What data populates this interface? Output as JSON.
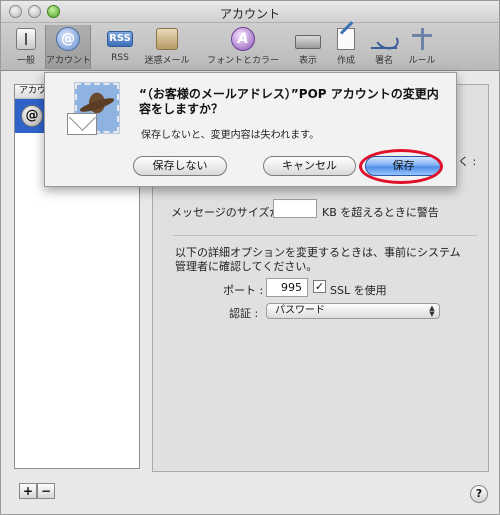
{
  "window": {
    "title": "アカウント"
  },
  "toolbar": {
    "items": [
      {
        "label": "一般",
        "icon": "general-icon"
      },
      {
        "label": "アカウント",
        "icon": "account-icon"
      },
      {
        "label": "RSS",
        "icon": "rss-icon",
        "icon_text": "RSS"
      },
      {
        "label": "迷惑メール",
        "icon": "junk-icon"
      },
      {
        "label": "フォントとカラー",
        "icon": "font-color-icon"
      },
      {
        "label": "表示",
        "icon": "view-icon"
      },
      {
        "label": "作成",
        "icon": "compose-icon"
      },
      {
        "label": "署名",
        "icon": "signature-icon"
      },
      {
        "label": "ルール",
        "icon": "rules-icon"
      }
    ]
  },
  "account_list": {
    "header": "アカウ"
  },
  "panel": {
    "partial_right_text": "く :",
    "message_size_label": "メッセージのサイズが",
    "message_size_suffix": "KB を超えるときに警告",
    "advanced_note": "以下の詳細オプションを変更するときは、事前にシステム管理者に確認してください。",
    "port_label": "ポート :",
    "port_value": "995",
    "ssl_label": "SSL を使用",
    "ssl_checked": true,
    "auth_label": "認証 :",
    "auth_value": "パスワード"
  },
  "sheet": {
    "title": "“（お客様のメールアドレス）”POP アカウントの変更内容をしますか？",
    "message": "保存しないと、変更内容は失われます。",
    "buttons": {
      "dont_save": "保存しない",
      "cancel": "キャンセル",
      "save": "保存"
    }
  },
  "bottom": {
    "add": "+",
    "remove": "−",
    "help": "?"
  },
  "colors": {
    "accent": "#4f8fe8",
    "highlight_ring": "#e0102a",
    "selection": "#2f63c9"
  }
}
